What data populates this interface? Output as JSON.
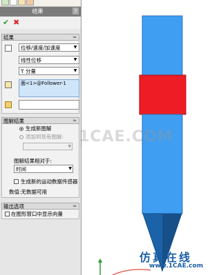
{
  "panel": {
    "title": "结果",
    "help": "?",
    "ok_icon": "check-icon",
    "cancel_icon": "x-icon",
    "ok_glyph": "✔",
    "cancel_glyph": "✖",
    "results": {
      "header": "结果",
      "collapse": "≈",
      "dropdown1": "位移/速度/加速度",
      "dropdown2": "线性位移",
      "dropdown3": "Y 分量",
      "selection_item": "面<1>@Follower-1"
    },
    "plot_results": {
      "header": "图解结果",
      "collapse": "≈",
      "radio_new": "生成新图解",
      "radio_existing": "添加到现有图解:",
      "relative_label": "图解结果相对于:",
      "relative_value": "时间",
      "sensor_checkbox": "生成新的运动数据传感器",
      "status": "数值:无数据可用"
    },
    "output_options": {
      "header": "输出选项",
      "collapse": "≈",
      "show_vector_checkbox": "在图形窗口中显示向量"
    }
  },
  "graphics": {
    "watermark_site": "1CAE.COM",
    "watermark_logo_cn": "仿真在线",
    "watermark_logo_url": "www.1CAE.com",
    "colors": {
      "shaft": "#3f9ef2",
      "shaft_edge": "#2c6fb5",
      "collar": "#ee1c24",
      "tip": "#1b63a8",
      "accent_red": "#e53b2f",
      "accent_green": "#2d9a2d"
    }
  }
}
